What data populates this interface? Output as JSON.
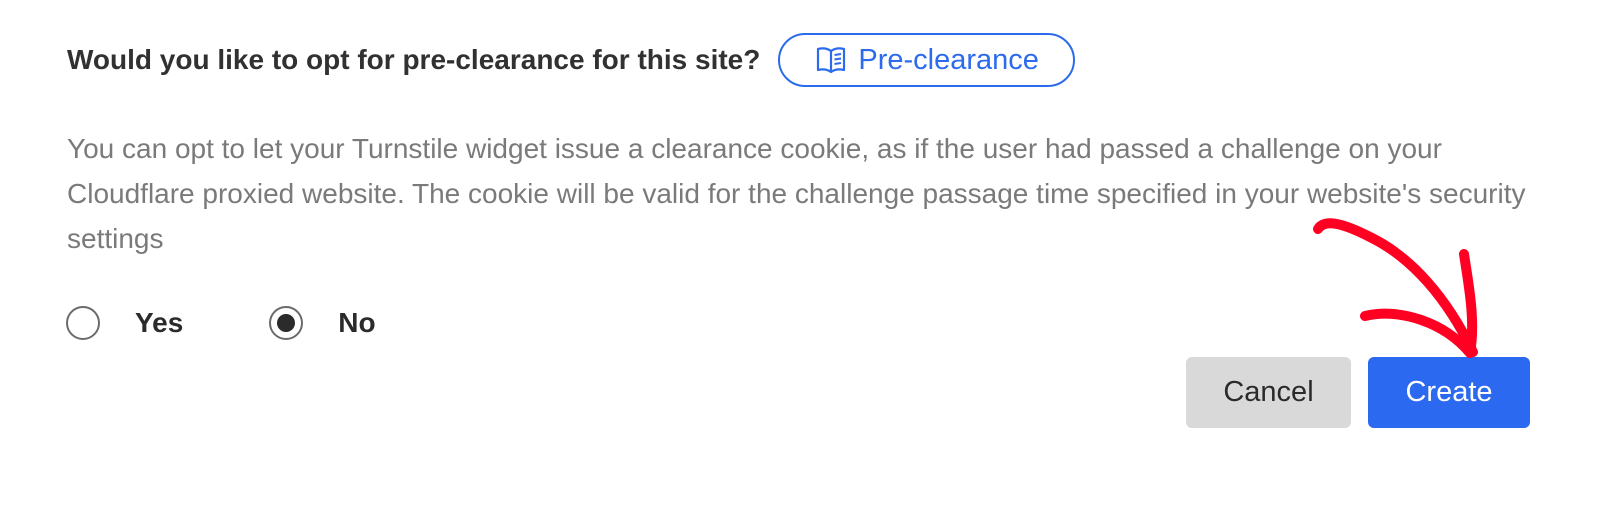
{
  "question": {
    "text": "Would you like to opt for pre-clearance for this site?",
    "doc_link_label": "Pre-clearance",
    "doc_link_icon": "book-open-icon"
  },
  "description": "You can opt to let your Turnstile widget issue a clearance cookie, as if the user had passed a challenge on your Cloudflare proxied website. The cookie will be valid for the challenge passage time specified in your website's security settings",
  "options": [
    {
      "label": "Yes",
      "selected": false
    },
    {
      "label": "No",
      "selected": true
    }
  ],
  "actions": {
    "cancel_label": "Cancel",
    "create_label": "Create"
  },
  "colors": {
    "accent": "#2b69f0",
    "annotation": "#ff0022"
  }
}
